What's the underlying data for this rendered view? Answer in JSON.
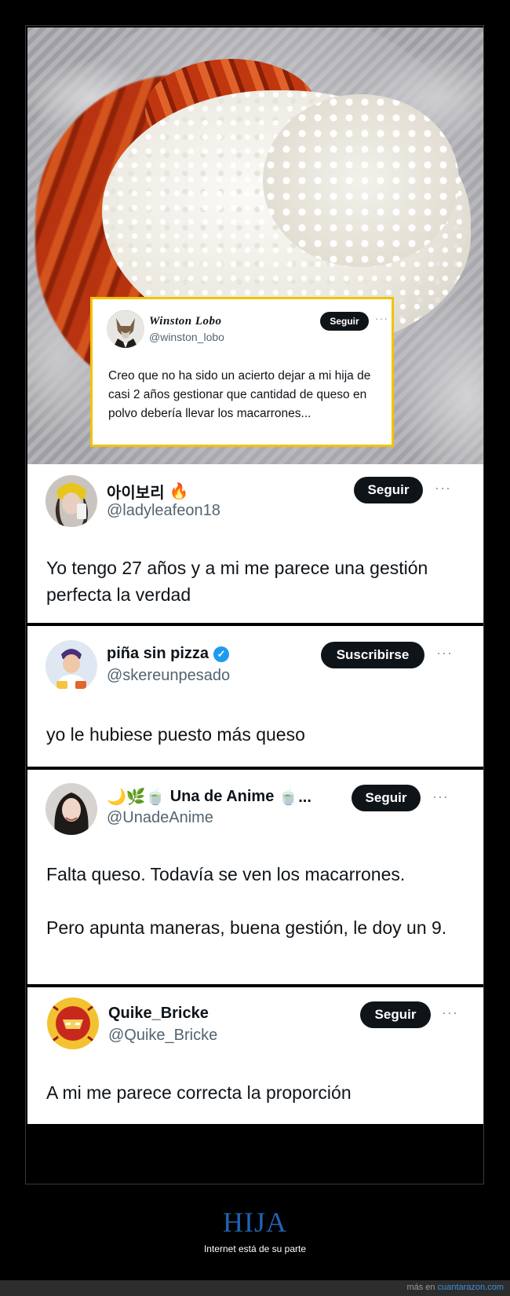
{
  "image_card": {
    "name": "Winston Lobo",
    "handle": "@winston_lobo",
    "follow_label": "Seguir",
    "more": "···",
    "text": "Creo que no ha sido un acierto dejar a mi hija de casi 2 años gestionar que cantidad de queso en polvo debería llevar los macarrones...",
    "border_color": "#f2c400"
  },
  "replies": [
    {
      "name": "아이보리",
      "name_emoji": "🔥",
      "handle": "@ladyleafeon18",
      "button": "Seguir",
      "more": "···",
      "text": "Yo tengo 27 años y a mi me parece una gestión perfecta la verdad"
    },
    {
      "name": "piña sin pizza",
      "verified": "✓",
      "handle": "@skereunpesado",
      "button": "Suscribirse",
      "more": "···",
      "text": "yo le hubiese puesto más queso"
    },
    {
      "name_prefix": "🌙🌿🍵",
      "name": "Una de Anime",
      "name_suffix": "🍵...",
      "handle": "@UnadeAnime",
      "button": "Seguir",
      "more": "···",
      "text_1": "Falta queso. Todavía se ven los macarrones.",
      "text_2": "Pero apunta maneras, buena gestión, le doy un 9."
    },
    {
      "name": "Quike_Bricke",
      "handle": "@Quike_Bricke",
      "button": "Seguir",
      "more": "···",
      "text": "A mi me parece correcta la proporción"
    }
  ],
  "footer": {
    "title": "HIJA",
    "subtitle": "Internet está de su parte",
    "more_prefix": "más en",
    "site": "cuantarazon.com",
    "title_color": "#1f64b3"
  }
}
